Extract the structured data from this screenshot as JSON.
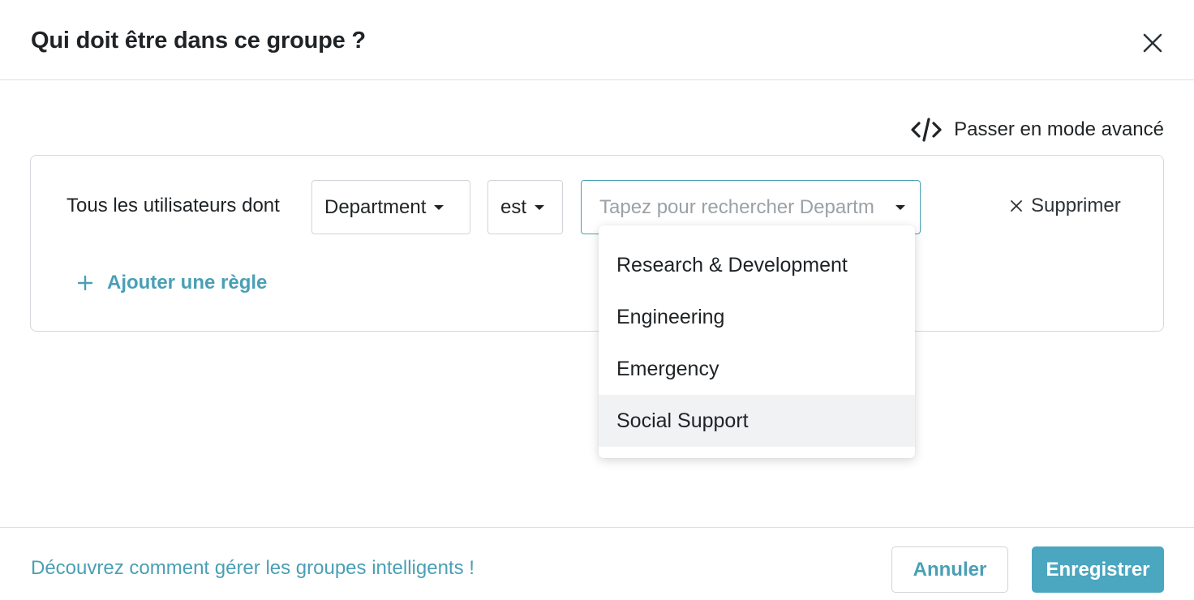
{
  "dialog": {
    "title": "Qui doit être dans ce groupe ?",
    "close_icon": "close-icon"
  },
  "advanced_mode": {
    "label": "Passer en mode avancé",
    "icon": "code-icon"
  },
  "rule": {
    "label": "Tous les utilisateurs dont",
    "field_value": "Department",
    "operator_value": "est",
    "value_placeholder": "Tapez pour rechercher Department",
    "delete_label": "Supprimer",
    "delete_icon": "close-icon"
  },
  "add_rule": {
    "label": "Ajouter une règle",
    "icon": "plus-icon"
  },
  "dropdown": {
    "options": [
      "Research & Development",
      "Engineering",
      "Emergency",
      "Social Support"
    ],
    "highlighted_option": "Social Support"
  },
  "footer": {
    "help_link": "Découvrez comment gérer les groupes intelligents !",
    "cancel_label": "Annuler",
    "save_label": "Enregistrer"
  },
  "colors": {
    "accent": "#4a9fb5",
    "primary_button": "#4ba6bf",
    "text": "#1f2326",
    "border": "#d4d8dc",
    "placeholder": "#9ba1a6",
    "hover_row": "#f1f2f4"
  }
}
